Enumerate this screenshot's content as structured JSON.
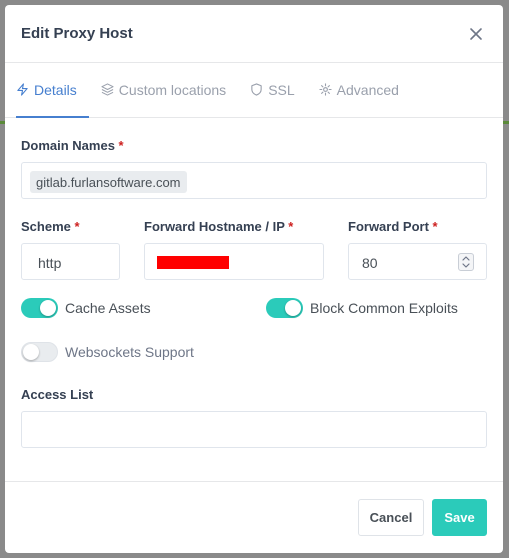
{
  "modal": {
    "title": "Edit Proxy Host"
  },
  "tabs": [
    {
      "label": "Details",
      "icon": "zap-icon",
      "active": true
    },
    {
      "label": "Custom locations",
      "icon": "layers-icon",
      "active": false
    },
    {
      "label": "SSL",
      "icon": "shield-icon",
      "active": false
    },
    {
      "label": "Advanced",
      "icon": "gear-icon",
      "active": false
    }
  ],
  "form": {
    "domain_names": {
      "label": "Domain Names",
      "required": "*",
      "chips": [
        "gitlab.furlansoftware.com"
      ]
    },
    "scheme": {
      "label": "Scheme",
      "required": "*",
      "value": "http"
    },
    "forward_host": {
      "label": "Forward Hostname / IP",
      "required": "*",
      "value": ""
    },
    "forward_port": {
      "label": "Forward Port",
      "required": "*",
      "value": "80"
    },
    "toggles": {
      "cache_assets": {
        "label": "Cache Assets",
        "on": true
      },
      "block_exploits": {
        "label": "Block Common Exploits",
        "on": true
      },
      "websockets": {
        "label": "Websockets Support",
        "on": false
      }
    },
    "access_list": {
      "label": "Access List",
      "value": ""
    }
  },
  "footer": {
    "cancel_label": "Cancel",
    "save_label": "Save"
  },
  "colors": {
    "accent": "#467fcf",
    "teal": "#2bcbba",
    "required": "#cd201f",
    "redaction": "#ff0000"
  }
}
